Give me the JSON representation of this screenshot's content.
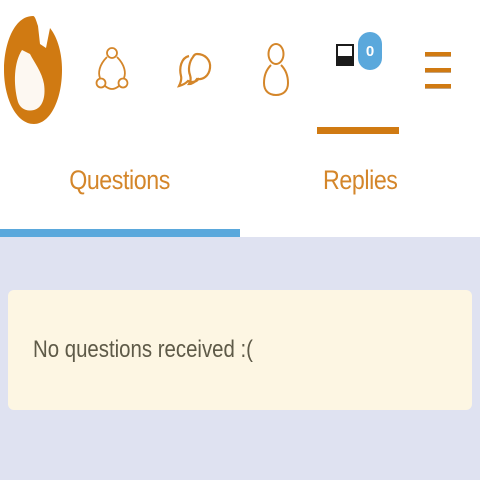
{
  "nav": {
    "items": [
      {
        "icon": "network-icon"
      },
      {
        "icon": "chat-bubbles-icon"
      },
      {
        "icon": "profile-icon"
      },
      {
        "icon": "inbox-icon",
        "badge": "0"
      },
      {
        "icon": "hamburger-menu-icon"
      }
    ]
  },
  "tabs": [
    {
      "label": "Questions",
      "active": true
    },
    {
      "label": "Replies",
      "active": false
    }
  ],
  "empty_state": {
    "message": "No questions received :("
  },
  "colors": {
    "accent_orange": "#d07a12",
    "tab_text": "#d4862a",
    "active_blue": "#5aa8dc",
    "page_background": "#dfe2f1",
    "notice_background": "#fdf6e3"
  }
}
